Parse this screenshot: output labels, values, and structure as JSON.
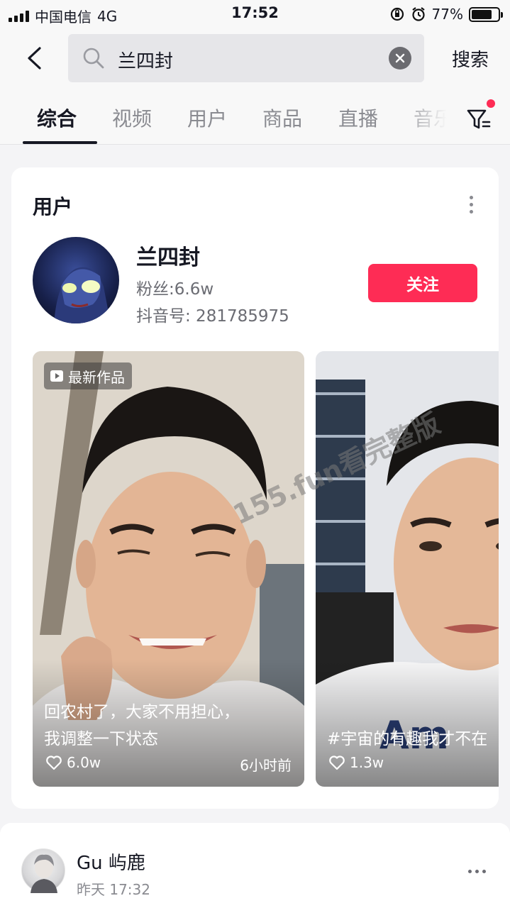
{
  "status_bar": {
    "carrier": "中国电信",
    "network": "4G",
    "time": "17:52",
    "battery_percent": "77%",
    "battery_level": 0.77
  },
  "search": {
    "query": "兰四封",
    "submit_label": "搜索"
  },
  "tabs": [
    {
      "label": "综合",
      "active": true
    },
    {
      "label": "视频",
      "active": false
    },
    {
      "label": "用户",
      "active": false
    },
    {
      "label": "商品",
      "active": false
    },
    {
      "label": "直播",
      "active": false
    },
    {
      "label": "音乐",
      "active": false
    }
  ],
  "user_card": {
    "section_title": "用户",
    "name": "兰四封",
    "fans": "粉丝:6.6w",
    "douyin_id": "抖音号: 281785975",
    "follow_label": "关注",
    "videos": [
      {
        "badge": "最新作品",
        "caption_line1": "回农村了，大家不用担心，",
        "caption_line2": "我调整一下状态",
        "likes": "6.0w",
        "time": "6小时前"
      },
      {
        "caption_line1": "",
        "caption_line2": "#宇宙的有趣我才不在",
        "likes": "1.3w"
      }
    ]
  },
  "watermark": "155.fun看完整版",
  "comment": {
    "user": "Gu 屿鹿",
    "time": "昨天 17:32"
  },
  "colors": {
    "accent": "#fe2c55",
    "text_primary": "#161823",
    "text_secondary": "#8a8b91"
  }
}
